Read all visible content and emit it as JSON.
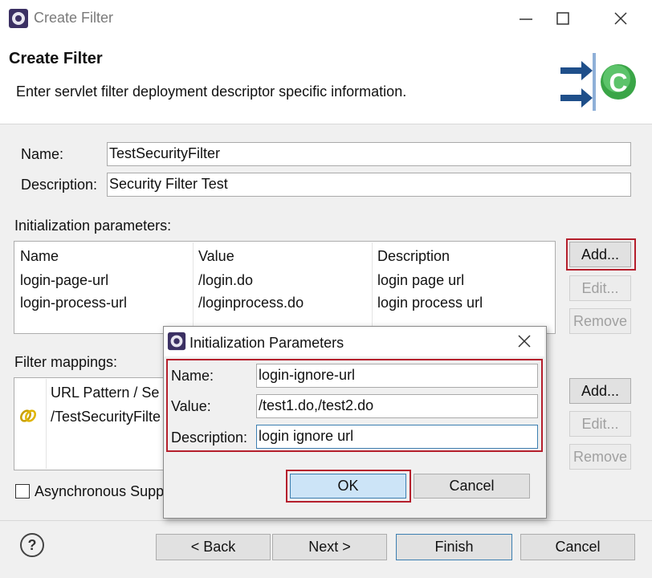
{
  "window": {
    "title": "Create Filter",
    "minimize_icon": "minimize-icon",
    "maximize_icon": "maximize-icon",
    "close_icon": "close-icon"
  },
  "header": {
    "title": "Create Filter",
    "subtitle": "Enter servlet filter deployment descriptor specific information.",
    "banner_icon": "create-filter-wizard-icon"
  },
  "form": {
    "name_label": "Name:",
    "name_value": "TestSecurityFilter",
    "description_label": "Description:",
    "description_value": "Security Filter Test"
  },
  "init_params": {
    "label": "Initialization parameters:",
    "columns": [
      "Name",
      "Value",
      "Description"
    ],
    "rows": [
      [
        "login-page-url",
        "/login.do",
        "login page url"
      ],
      [
        "login-process-url",
        "/loginprocess.do",
        "login process url"
      ]
    ],
    "buttons": {
      "add": "Add...",
      "edit": "Edit...",
      "remove": "Remove"
    }
  },
  "filter_mappings": {
    "label": "Filter mappings:",
    "column": "URL Pattern / Se",
    "row": "/TestSecurityFilte",
    "row_icon": "url-pattern-icon",
    "buttons": {
      "add": "Add...",
      "edit": "Edit...",
      "remove": "Remove"
    }
  },
  "async": {
    "label": "Asynchronous Supp",
    "checked": false
  },
  "footer": {
    "back": "< Back",
    "next": "Next >",
    "finish": "Finish",
    "cancel": "Cancel",
    "help_icon": "help-icon"
  },
  "dialog": {
    "title": "Initialization Parameters",
    "name_label": "Name:",
    "name_value": "login-ignore-url",
    "value_label": "Value:",
    "value_value": "/test1.do,/test2.do",
    "description_label": "Description:",
    "description_value": "login ignore url",
    "ok": "OK",
    "cancel": "Cancel"
  },
  "colors": {
    "highlight": "#b51f2c",
    "focus": "#3c7fb1",
    "ok_fill": "#cce4f7"
  }
}
